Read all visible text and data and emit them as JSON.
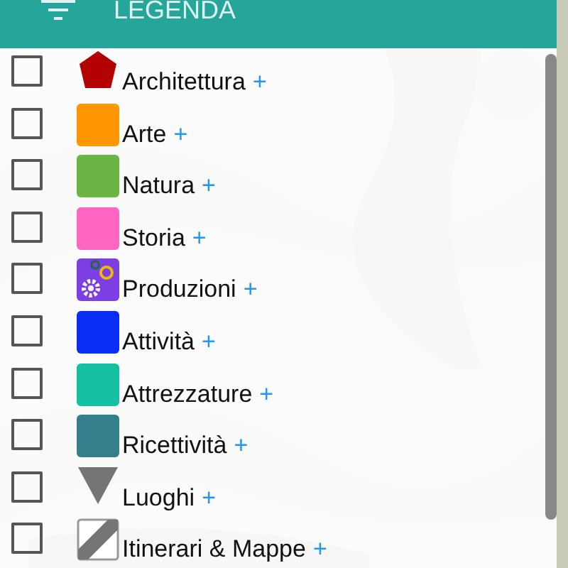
{
  "header": {
    "title": "LEGENDA"
  },
  "items": [
    {
      "label": "Architettura",
      "plus": "+",
      "checked": false,
      "kind": "pentagon",
      "color": "#b30000"
    },
    {
      "label": "Arte",
      "plus": "+",
      "checked": false,
      "kind": "square",
      "color": "#ff9800"
    },
    {
      "label": "Natura",
      "plus": "+",
      "checked": false,
      "kind": "square",
      "color": "#6ab344"
    },
    {
      "label": "Storia",
      "plus": "+",
      "checked": false,
      "kind": "square",
      "color": "#ff66c4"
    },
    {
      "label": "Produzioni",
      "plus": "+",
      "checked": false,
      "kind": "gears",
      "color": "#7b3fe4"
    },
    {
      "label": "Attività",
      "plus": "+",
      "checked": false,
      "kind": "square",
      "color": "#0a2cf5"
    },
    {
      "label": "Attrezzature",
      "plus": "+",
      "checked": false,
      "kind": "square",
      "color": "#14c0a0"
    },
    {
      "label": "Ricettività",
      "plus": "+",
      "checked": false,
      "kind": "square",
      "color": "#347f8c"
    },
    {
      "label": "Luoghi",
      "plus": "+",
      "checked": false,
      "kind": "triangle",
      "color": "#757575"
    },
    {
      "label": "Itinerari & Mappe",
      "plus": "+",
      "checked": false,
      "kind": "diagonal",
      "color": "#757575"
    }
  ]
}
